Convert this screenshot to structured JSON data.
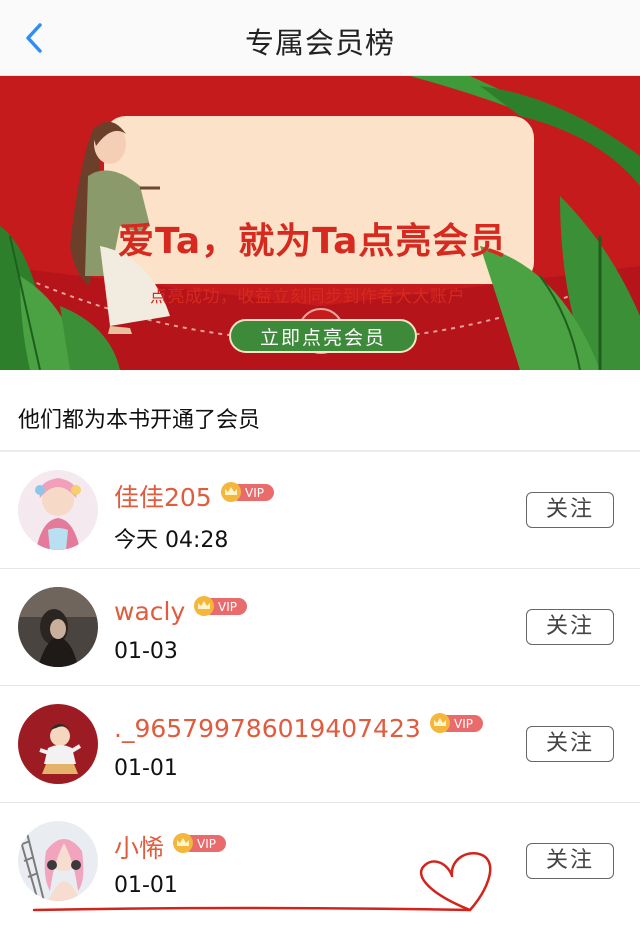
{
  "header": {
    "title": "专属会员榜"
  },
  "banner": {
    "title": "爱Ta，就为Ta点亮会员",
    "subtitle": "点亮成功，收益立刻同步到作者大大账户",
    "cta_label": "立即点亮会员"
  },
  "section_heading": "他们都为本书开通了会员",
  "members": [
    {
      "name": "佳佳205",
      "badge": "VIP",
      "time": "今天 04:28",
      "follow_label": "关注"
    },
    {
      "name": "wacly",
      "badge": "VIP",
      "time": "01-03",
      "follow_label": "关注"
    },
    {
      "name": "._965799786019407423",
      "badge": "VIP",
      "time": "01-01",
      "follow_label": "关注"
    },
    {
      "name": "小悕",
      "badge": "VIP",
      "time": "01-01",
      "follow_label": "关注"
    }
  ],
  "icons": {
    "back": "chevron-left-icon",
    "vip": "crown-icon",
    "seal": "heart-seal-icon"
  },
  "colors": {
    "accent_blue": "#2f8ef5",
    "banner_red": "#c61b1c",
    "name_orange": "#e15b3d",
    "cta_green": "#3e8a3b",
    "annotation_red": "#d3241c"
  }
}
